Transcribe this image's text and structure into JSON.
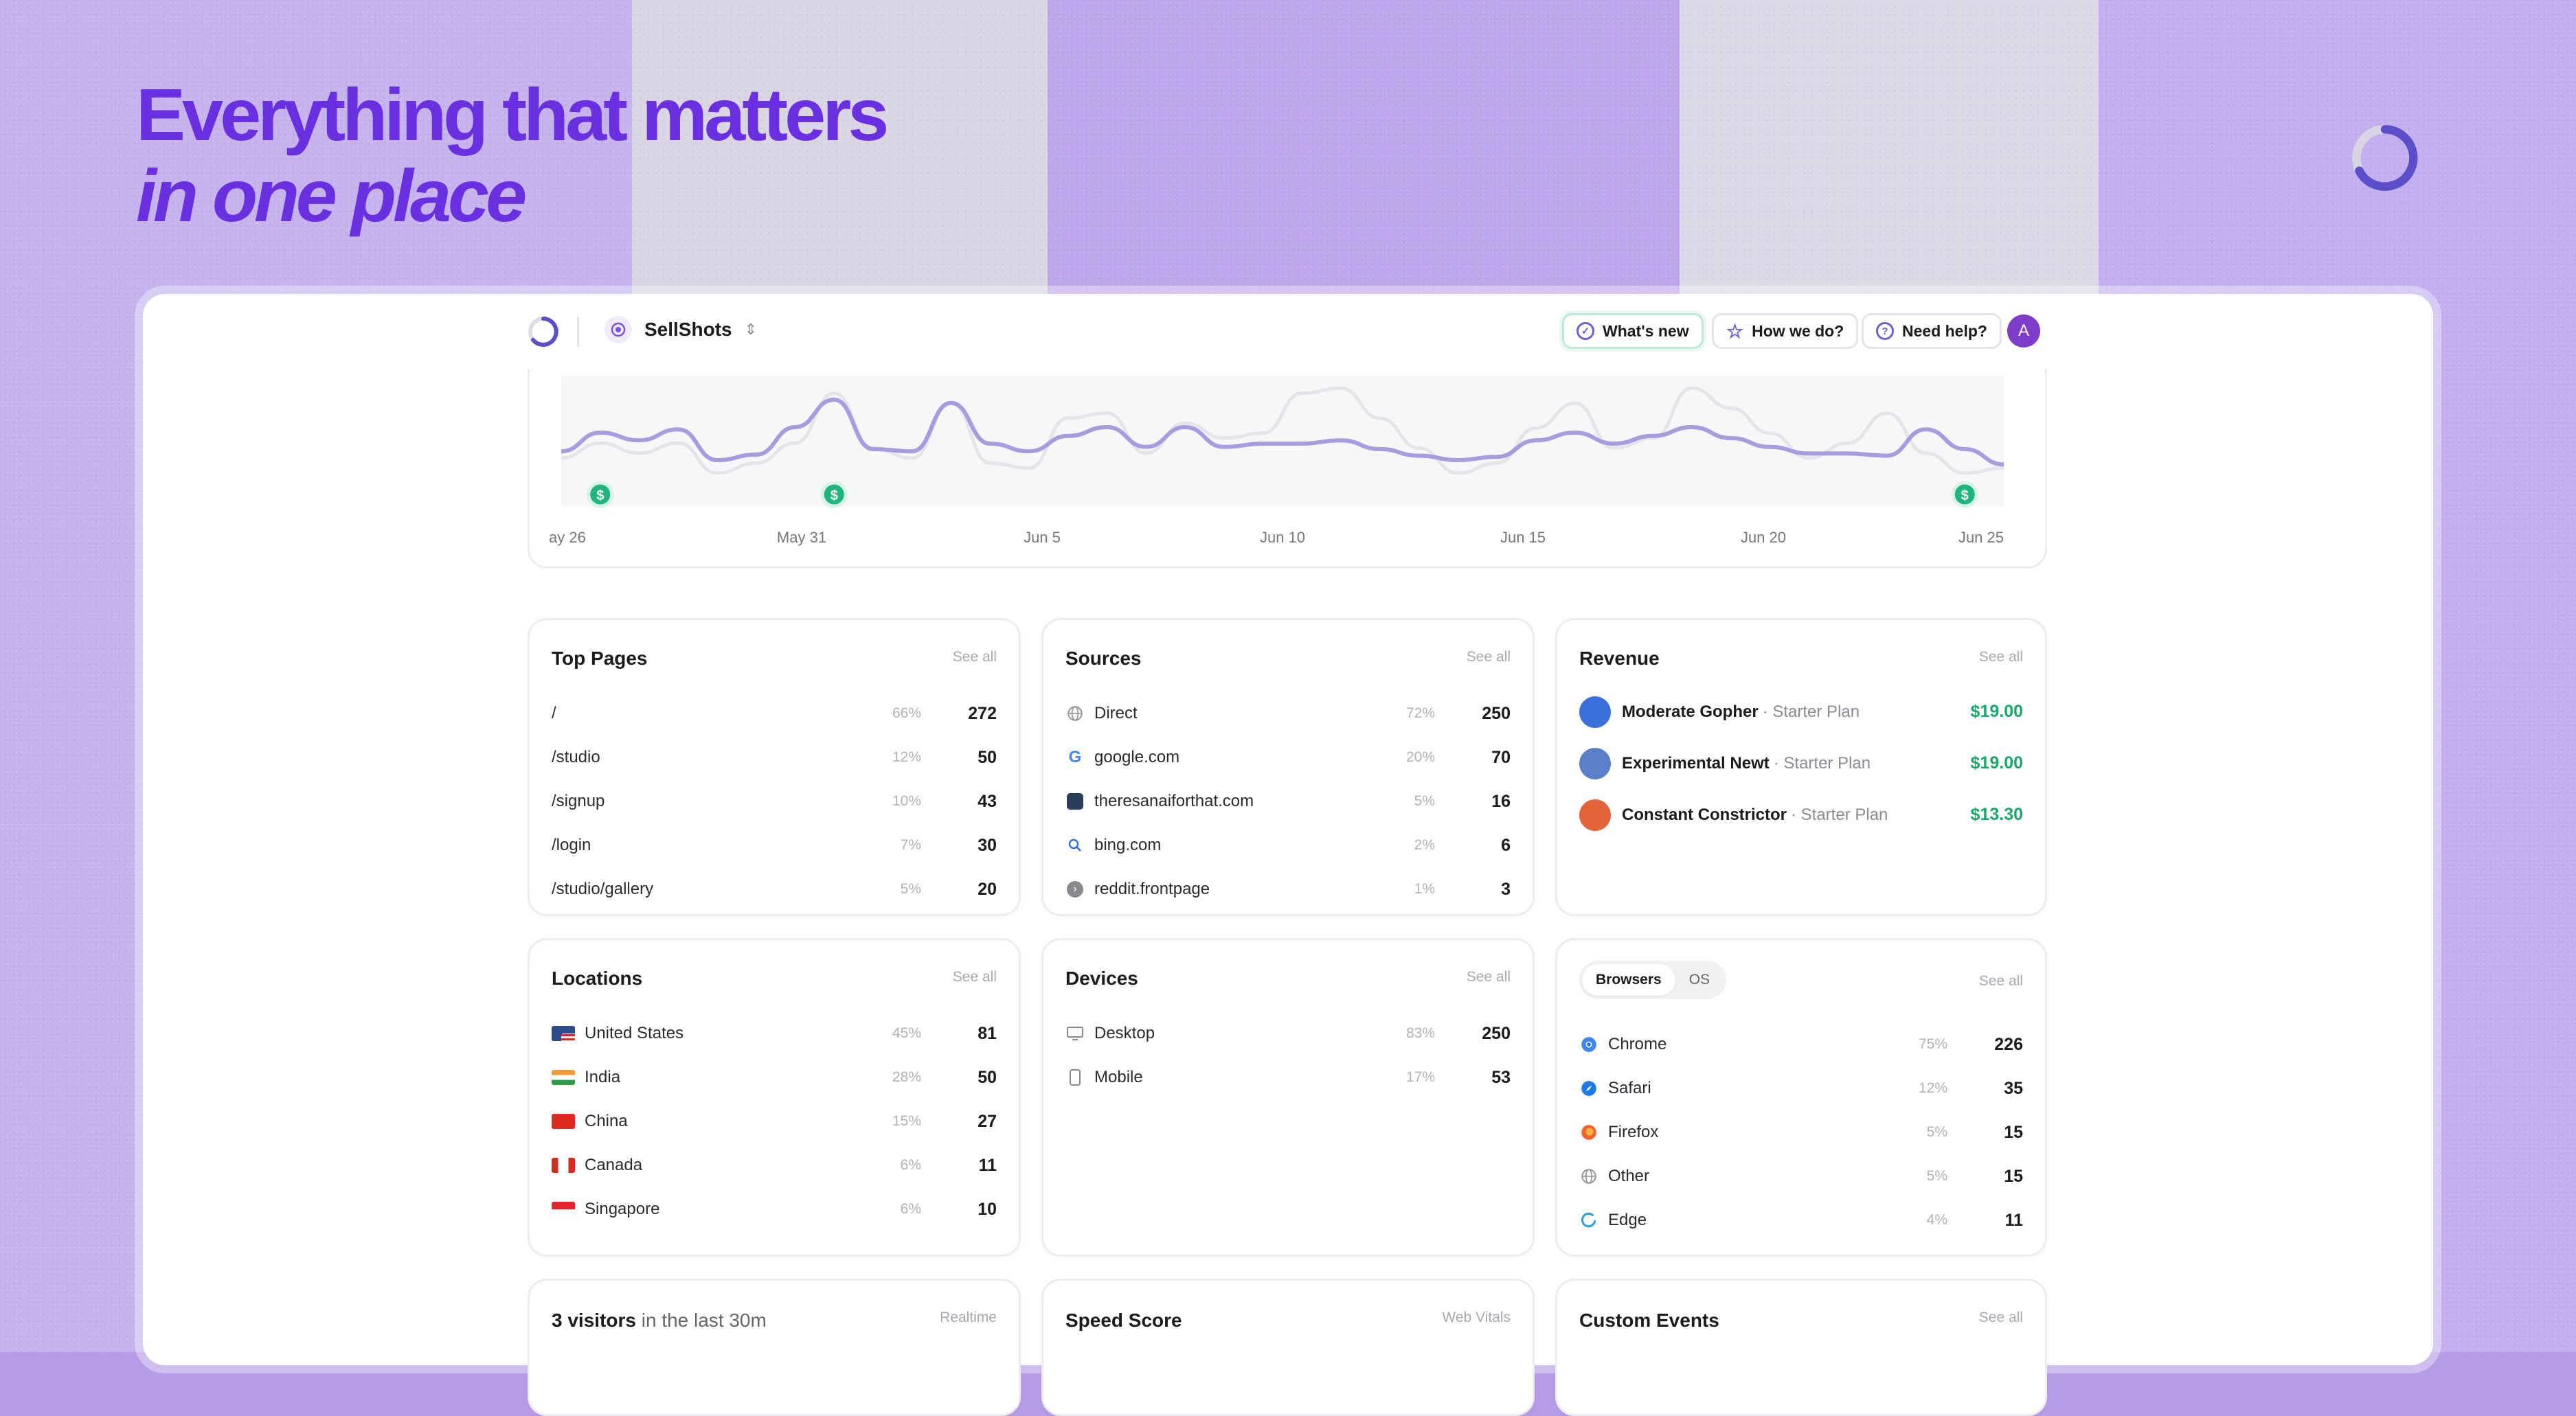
{
  "hero": {
    "line1": "Everything that matters",
    "line2": "in one place"
  },
  "header": {
    "site_name": "SellShots",
    "whats_new": "What's new",
    "how_we_do": "How we do?",
    "need_help": "Need help?",
    "avatar_letter": "A"
  },
  "chart_data": {
    "type": "line",
    "x_labels": [
      "ay 26",
      "May 31",
      "Jun 5",
      "Jun 10",
      "Jun 15",
      "Jun 20",
      "Jun 25"
    ],
    "series": [
      {
        "values": [
          38,
          55,
          48,
          58,
          30,
          35,
          60,
          85,
          40,
          38,
          82,
          45,
          38,
          52,
          60,
          42,
          60,
          42,
          45,
          45,
          48,
          40,
          34,
          30,
          33,
          48,
          55,
          45,
          52,
          60,
          50,
          42,
          36,
          36,
          34,
          58,
          40,
          26
        ]
      },
      {
        "values": [
          70,
          100,
          80,
          100,
          40,
          60,
          100,
          200,
          90,
          70,
          180,
          60,
          50,
          150,
          160,
          80,
          140,
          110,
          120,
          200,
          210,
          150,
          90,
          40,
          60,
          130,
          180,
          90,
          110,
          210,
          170,
          120,
          70,
          100,
          160,
          80,
          40,
          50
        ]
      }
    ],
    "revenue_markers": [
      1,
      7,
      36
    ]
  },
  "top_pages": {
    "title": "Top Pages",
    "see_all": "See all",
    "rows": [
      {
        "label": "/",
        "pct": "66%",
        "num": "272"
      },
      {
        "label": "/studio",
        "pct": "12%",
        "num": "50"
      },
      {
        "label": "/signup",
        "pct": "10%",
        "num": "43"
      },
      {
        "label": "/login",
        "pct": "7%",
        "num": "30"
      },
      {
        "label": "/studio/gallery",
        "pct": "5%",
        "num": "20"
      }
    ]
  },
  "sources": {
    "title": "Sources",
    "see_all": "See all",
    "rows": [
      {
        "label": "Direct",
        "pct": "72%",
        "num": "250",
        "icon": "globe-icon"
      },
      {
        "label": "google.com",
        "pct": "20%",
        "num": "70",
        "icon": "google-icon"
      },
      {
        "label": "theresanaiforthat.com",
        "pct": "5%",
        "num": "16",
        "icon": "site-icon"
      },
      {
        "label": "bing.com",
        "pct": "2%",
        "num": "6",
        "icon": "bing-icon"
      },
      {
        "label": "reddit.frontpage",
        "pct": "1%",
        "num": "3",
        "icon": "reddit-icon"
      }
    ]
  },
  "revenue": {
    "title": "Revenue",
    "see_all": "See all",
    "rows": [
      {
        "name": "Moderate Gopher",
        "plan": "· Starter Plan",
        "amount": "$19.00",
        "color": "#3b6fd9"
      },
      {
        "name": "Experimental Newt",
        "plan": "· Starter Plan",
        "amount": "$19.00",
        "color": "#5b7fc9"
      },
      {
        "name": "Constant Constrictor",
        "plan": "· Starter Plan",
        "amount": "$13.30",
        "color": "#e0633a"
      }
    ]
  },
  "locations": {
    "title": "Locations",
    "see_all": "See all",
    "rows": [
      {
        "label": "United States",
        "pct": "45%",
        "num": "81"
      },
      {
        "label": "India",
        "pct": "28%",
        "num": "50"
      },
      {
        "label": "China",
        "pct": "15%",
        "num": "27"
      },
      {
        "label": "Canada",
        "pct": "6%",
        "num": "11"
      },
      {
        "label": "Singapore",
        "pct": "6%",
        "num": "10"
      }
    ]
  },
  "devices": {
    "title": "Devices",
    "see_all": "See all",
    "rows": [
      {
        "label": "Desktop",
        "pct": "83%",
        "num": "250"
      },
      {
        "label": "Mobile",
        "pct": "17%",
        "num": "53"
      }
    ]
  },
  "browsers": {
    "tab_browsers": "Browsers",
    "tab_os": "OS",
    "see_all": "See all",
    "rows": [
      {
        "label": "Chrome",
        "pct": "75%",
        "num": "226"
      },
      {
        "label": "Safari",
        "pct": "12%",
        "num": "35"
      },
      {
        "label": "Firefox",
        "pct": "5%",
        "num": "15"
      },
      {
        "label": "Other",
        "pct": "5%",
        "num": "15"
      },
      {
        "label": "Edge",
        "pct": "4%",
        "num": "11"
      }
    ]
  },
  "realtime": {
    "count": "3 visitors",
    "suffix": " in the last 30m",
    "tag": "Realtime"
  },
  "speed": {
    "title": "Speed Score",
    "tag": "Web Vitals"
  },
  "custom_events": {
    "title": "Custom Events",
    "see_all": "See all"
  },
  "colors": {
    "accent": "#6a2fe0",
    "line_main": "#a89be0",
    "line_ghost": "#e4e4e9",
    "revenue_green": "#1aa86a"
  }
}
